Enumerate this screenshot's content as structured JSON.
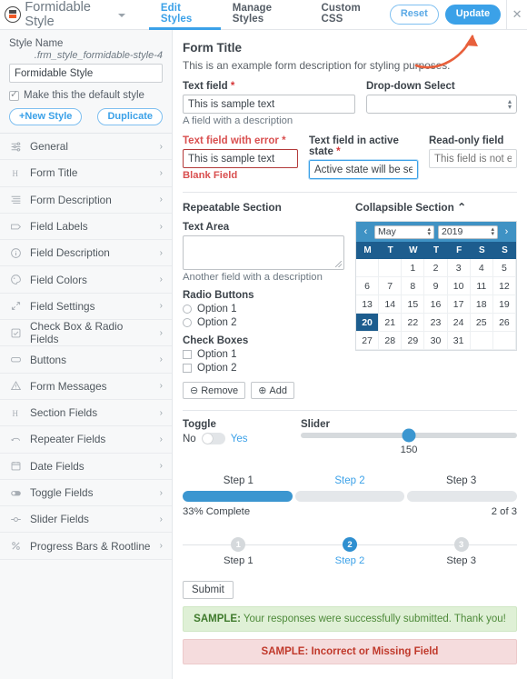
{
  "header": {
    "app_title": "Formidable Style",
    "caret": "chevron-down",
    "tabs": [
      {
        "label": "Edit Styles",
        "active": true
      },
      {
        "label": "Manage Styles",
        "active": false
      },
      {
        "label": "Custom CSS",
        "active": false
      }
    ],
    "reset_label": "Reset",
    "update_label": "Update",
    "close_label": "✕",
    "accent_blue": "#3ba1e8",
    "annotation_color": "#e8603c"
  },
  "sidebar": {
    "style_name_label": "Style Name",
    "style_slug": ".frm_style_formidable-style-4",
    "style_name_value": "Formidable Style",
    "default_checkbox_label": "Make this the default style",
    "default_checked": true,
    "new_style_label": "+New Style",
    "duplicate_label": "Duplicate",
    "items": [
      {
        "label": "General",
        "icon": "sliders-icon"
      },
      {
        "label": "Form Title",
        "icon": "heading-icon"
      },
      {
        "label": "Form Description",
        "icon": "text-lines-icon"
      },
      {
        "label": "Field Labels",
        "icon": "tag-icon"
      },
      {
        "label": "Field Description",
        "icon": "info-circle-icon"
      },
      {
        "label": "Field Colors",
        "icon": "palette-icon"
      },
      {
        "label": "Field Settings",
        "icon": "expand-arrows-icon"
      },
      {
        "label": "Check Box & Radio Fields",
        "icon": "checkbox-icon"
      },
      {
        "label": "Buttons",
        "icon": "button-icon"
      },
      {
        "label": "Form Messages",
        "icon": "warning-triangle-icon"
      },
      {
        "label": "Section Fields",
        "icon": "heading-icon"
      },
      {
        "label": "Repeater Fields",
        "icon": "repeat-icon"
      },
      {
        "label": "Date Fields",
        "icon": "calendar-icon"
      },
      {
        "label": "Toggle Fields",
        "icon": "toggle-icon"
      },
      {
        "label": "Slider Fields",
        "icon": "slider-icon"
      },
      {
        "label": "Progress Bars & Rootline",
        "icon": "percent-icon"
      }
    ],
    "chevron": "›"
  },
  "form": {
    "title": "Form Title",
    "description": "This is an example form description for styling purposes.",
    "text_field": {
      "label": "Text field",
      "required_mark": "*",
      "value": "This is sample text",
      "description": "A field with a description"
    },
    "dropdown": {
      "label": "Drop-down Select",
      "value": "",
      "options": [
        ""
      ]
    },
    "error_field": {
      "label": "Text field with error",
      "required_mark": "*",
      "value": "This is sample text",
      "error_text": "Blank Field"
    },
    "active_field": {
      "label": "Text field in active state",
      "required_mark": "*",
      "value": "Active state will be seen when typing"
    },
    "readonly_field": {
      "label": "Read-only field",
      "placeholder": "This field is not editable",
      "value": ""
    },
    "repeatable_section": {
      "title": "Repeatable Section",
      "textarea_label": "Text Area",
      "textarea_value": "",
      "textarea_description": "Another field with a description",
      "radio_title": "Radio Buttons",
      "radio_options": [
        "Option 1",
        "Option 2"
      ],
      "checkbox_title": "Check Boxes",
      "checkbox_options": [
        "Option 1",
        "Option 2"
      ],
      "remove_label": "Remove",
      "add_label": "Add",
      "remove_icon": "minus-circle-icon",
      "add_icon": "plus-circle-icon"
    },
    "collapsible_section": {
      "title": "Collapsible Section",
      "chevron": "⌃",
      "calendar": {
        "prev": "‹",
        "next": "›",
        "month": "May",
        "year": "2019",
        "dow": [
          "M",
          "T",
          "W",
          "T",
          "F",
          "S",
          "S"
        ],
        "lead_blanks": 2,
        "days": [
          1,
          2,
          3,
          4,
          5,
          6,
          7,
          8,
          9,
          10,
          11,
          12,
          13,
          14,
          15,
          16,
          17,
          18,
          19,
          20,
          21,
          22,
          23,
          24,
          25,
          26,
          27,
          28,
          29,
          30,
          31
        ],
        "selected_day": 20,
        "header_color": "#3f92c4",
        "dow_color": "#1d5d8e"
      }
    },
    "toggle": {
      "label": "Toggle",
      "off_label": "No",
      "on_label": "Yes",
      "state": "off"
    },
    "slider": {
      "label": "Slider",
      "value": "150",
      "percent": 50
    },
    "progress": {
      "steps": [
        {
          "label": "Step 1",
          "active": false
        },
        {
          "label": "Step 2",
          "active": true
        },
        {
          "label": "Step 3",
          "active": false
        }
      ],
      "filled_segments": 1,
      "percent_text": "33% Complete",
      "counter_text": "2 of 3",
      "fill_color": "#3b96d0"
    },
    "rootline": {
      "steps": [
        {
          "number": "1",
          "label": "Step 1",
          "active": false
        },
        {
          "number": "2",
          "label": "Step 2",
          "active": true
        },
        {
          "number": "3",
          "label": "Step 3",
          "active": false
        }
      ]
    },
    "submit_label": "Submit",
    "success_message_prefix": "SAMPLE:",
    "success_message": " Your responses were successfully submitted. Thank you!",
    "error_message": "SAMPLE: Incorrect or Missing Field"
  }
}
